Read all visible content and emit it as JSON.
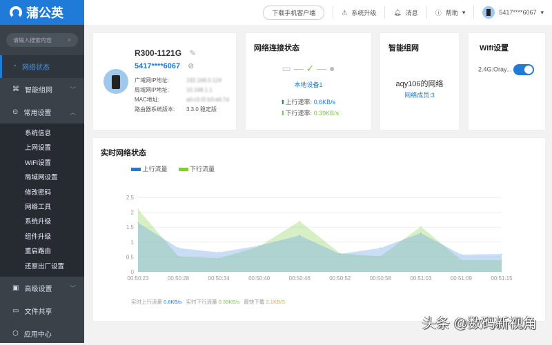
{
  "app": {
    "logo": "蒲公英"
  },
  "sidebar": {
    "search_placeholder": "请输入搜索内容",
    "items": [
      {
        "label": "网络状态",
        "icon": "dashboard-icon"
      },
      {
        "label": "智能组网",
        "icon": "network-icon"
      },
      {
        "label": "常用设置",
        "icon": "settings-icon"
      }
    ],
    "sub_items": [
      "系统信息",
      "上网设置",
      "WiFi设置",
      "局域网设置",
      "修改密码",
      "网络工具",
      "系统升级",
      "组件升级",
      "重启路由",
      "还原出厂设置"
    ],
    "bottom_items": [
      {
        "label": "高级设置"
      },
      {
        "label": "文件共享"
      },
      {
        "label": "应用中心"
      }
    ]
  },
  "header": {
    "download": "下载手机客户端",
    "upgrade": "系统升级",
    "messages": "消息",
    "help": "帮助",
    "user": "5417****6067"
  },
  "device": {
    "model": "R300-1121G",
    "sn": "5417****6067",
    "wan_label": "广域网IP地址:",
    "wan": "192.168.0.124",
    "lan_label": "局域网IP地址:",
    "lan": "10.168.1.1",
    "mac_label": "MAC地址:",
    "mac": "a0:c5:f2:b3:a6:7d",
    "ver_label": "路由器系统版本:",
    "ver": "3.3.0 稳定版"
  },
  "conn": {
    "title": "网络连接状态",
    "local": "本地设备1",
    "up_label": "上行速率:",
    "up": "0.6KB/s",
    "down_label": "下行速率:",
    "down": "0.39KB/s"
  },
  "mesh": {
    "title": "智能组网",
    "name": "aqy106的网络",
    "members": "网络成员:3"
  },
  "wifi": {
    "title": "Wifi设置",
    "band": "2.4G:",
    "ssid": "Oray...",
    "enabled": true
  },
  "realtime": {
    "title": "实时网络状态",
    "up_label": "实时上行流量",
    "up": "0.6KB/s",
    "down_label": "实时下行流量",
    "down": "0.39KB/s",
    "max_label": "最快下载",
    "max": "2.1KB/S"
  },
  "colors": {
    "accent": "#1f7ad8",
    "upload": "#1f7ad8",
    "download": "#7ed321"
  },
  "chart_data": {
    "type": "area",
    "title": "",
    "xlabel": "",
    "ylabel": "",
    "ylim": [
      0,
      2.5
    ],
    "yticks": [
      "0",
      "0.5",
      "1",
      "1.5",
      "2",
      "2.5"
    ],
    "categories": [
      "00:50:23",
      "00:50:28",
      "00:50:34",
      "00:50:40",
      "00:50:46",
      "00:50:52",
      "00:50:58",
      "00:51:03",
      "00:51:09",
      "00:51:15"
    ],
    "series": [
      {
        "name": "上行流量",
        "color": "#1f7ad8",
        "values": [
          1.65,
          0.8,
          0.65,
          0.88,
          1.22,
          0.6,
          0.8,
          1.3,
          0.58,
          0.6
        ]
      },
      {
        "name": "下行流量",
        "color": "#7ed321",
        "values": [
          2.1,
          0.52,
          0.45,
          0.85,
          1.7,
          0.62,
          0.52,
          1.52,
          0.4,
          0.4
        ]
      }
    ],
    "grid": true,
    "legend": "top-left"
  },
  "watermark": "头条 @数码新视角"
}
